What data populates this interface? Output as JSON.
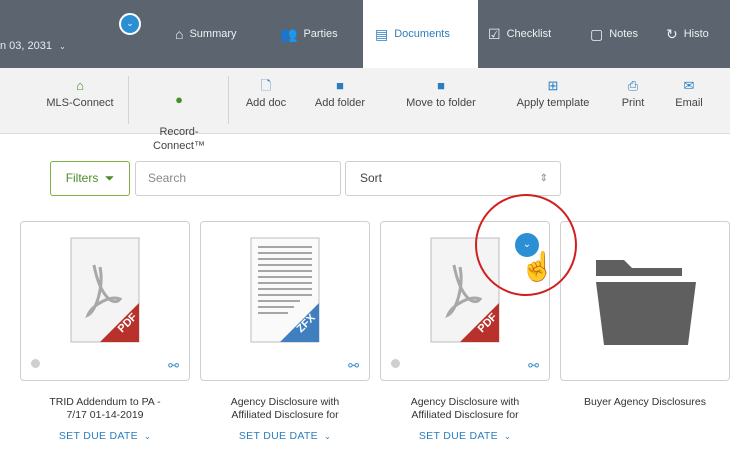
{
  "header": {
    "date_text": "n 03, 2031",
    "date_chevron": "⌄",
    "top_toggle_glyph": "⌄",
    "tabs": [
      {
        "label": "Summary",
        "icon": "home-icon",
        "glyph": "⌂"
      },
      {
        "label": "Parties",
        "icon": "people-icon",
        "glyph": "👥"
      },
      {
        "label": "Documents",
        "icon": "document-icon",
        "glyph": "▤"
      },
      {
        "label": "Checklist",
        "icon": "checklist-icon",
        "glyph": "☑"
      },
      {
        "label": "Notes",
        "icon": "notes-icon",
        "glyph": "▢"
      },
      {
        "label": "Histo",
        "icon": "history-icon",
        "glyph": "↻"
      }
    ],
    "active_tab": "Documents"
  },
  "toolbar": {
    "items": [
      {
        "label": "MLS-Connect",
        "icon": "mls-connect-icon",
        "glyph": "⌂"
      },
      {
        "label": "Record-\nConnect™",
        "icon": "record-connect-icon",
        "glyph": "●"
      },
      {
        "label": "Add doc",
        "icon": "add-doc-icon",
        "glyph": "🗋"
      },
      {
        "label": "Add folder",
        "icon": "add-folder-icon",
        "glyph": "■"
      },
      {
        "label": "Move to folder",
        "icon": "move-folder-icon",
        "glyph": "■"
      },
      {
        "label": "Apply template",
        "icon": "template-icon",
        "glyph": "⊞"
      },
      {
        "label": "Print",
        "icon": "print-icon",
        "glyph": "⎙"
      },
      {
        "label": "Email",
        "icon": "email-icon",
        "glyph": "✉"
      }
    ]
  },
  "filter_bar": {
    "filters_label": "Filters",
    "filters_glyph": "⏷",
    "search_placeholder": "Search",
    "sort_label": "Sort",
    "sort_glyph": "⇕"
  },
  "documents": [
    {
      "title": "TRID Addendum to PA -\n7/17 01-14-2019",
      "type": "pdf",
      "badge": "PDF",
      "due_label": "SET DUE DATE",
      "due_chevron": "⌄"
    },
    {
      "title": "Agency Disclosure with\nAffiliated Disclosure for",
      "type": "zfx",
      "badge": "ZFX",
      "due_label": "SET DUE DATE",
      "due_chevron": "⌄"
    },
    {
      "title": "Agency Disclosure with\nAffiliated Disclosure for",
      "type": "pdf",
      "badge": "PDF",
      "due_label": "SET DUE DATE",
      "due_chevron": "⌄"
    },
    {
      "title": "Buyer Agency Disclosures",
      "type": "folder",
      "badge": "",
      "due_label": "",
      "due_chevron": ""
    }
  ],
  "overlay": {
    "chevron_glyph": "⌄",
    "cursor_glyph": "☝",
    "highlight_color": "#d11f1f"
  },
  "colors": {
    "nav_bg": "#5b646f",
    "accent_blue": "#2b7dbf",
    "filter_green": "#4a8d2b",
    "pdf_red": "#b8322b",
    "zfx_blue": "#3f7fc0"
  }
}
